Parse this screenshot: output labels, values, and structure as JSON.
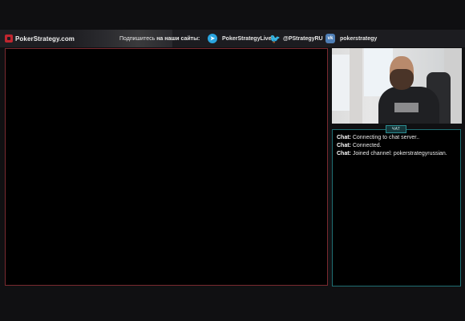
{
  "header": {
    "logo_text": "PokerStrategy.com",
    "subscribe_prefix": "Подпишитесь",
    "subscribe_bold": "на наши сайты:",
    "socials": [
      {
        "icon": "telegram-icon",
        "label": "PokerStrategyLive",
        "color": "#2aa5df"
      },
      {
        "icon": "twitter-icon",
        "label": "@PStrategyRU",
        "color": "#3ea1ec"
      },
      {
        "icon": "vk-icon",
        "label": "pokerstrategy",
        "color": "#4f7fb6"
      }
    ]
  },
  "chat": {
    "tab_label": "ЧАТ",
    "messages": [
      {
        "author": "Chat:",
        "text": "Connecting to chat server.."
      },
      {
        "author": "Chat:",
        "text": "Connected."
      },
      {
        "author": "Chat:",
        "text": "Joined channel: pokerstrategyrussian."
      }
    ]
  },
  "colors": {
    "brand": "#c0262f",
    "main_border": "#7a2a30",
    "chat_border": "#1f6f73"
  }
}
